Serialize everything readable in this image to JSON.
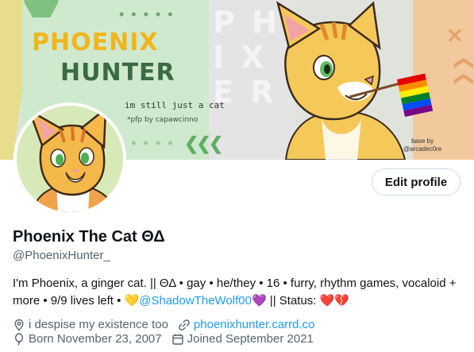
{
  "banner": {
    "title_line1": "PHOENIX",
    "title_line2": "HUNTER",
    "tagline": "im still just a cat",
    "pfp_credit": "*pfp by capawcinno",
    "base_credit_line1": "base by",
    "base_credit_line2": "@arcadec0re",
    "colors": {
      "yellow": "#f2b51a",
      "green": "#3a6b44",
      "mint": "#cfe9cf",
      "peach": "#f2c99d"
    }
  },
  "profile": {
    "display_name": "Phoenix The Cat ΘΔ",
    "handle": "@PhoenixHunter_",
    "edit_button": "Edit profile",
    "bio_part1": "I'm Phoenix, a ginger cat. || ΘΔ • gay • he/they • 16 • furry, rhythm games, vocaloid + more • 9/9 lives left • ",
    "bio_heart1": "💛",
    "bio_mention": "@ShadowTheWolf00",
    "bio_heart2": "💜",
    "bio_part2": " || Status: ",
    "bio_status_hearts": "❤️💔",
    "location": "i despise my existence too",
    "website": "phoenixhunter.carrd.co",
    "birthday": "Born November 23, 2007",
    "joined": "Joined September 2021"
  },
  "icons": {
    "location": "location-pin-icon",
    "link": "link-icon",
    "birthday": "balloon-icon",
    "joined": "calendar-icon"
  },
  "accent_color": "#1d9bf0"
}
